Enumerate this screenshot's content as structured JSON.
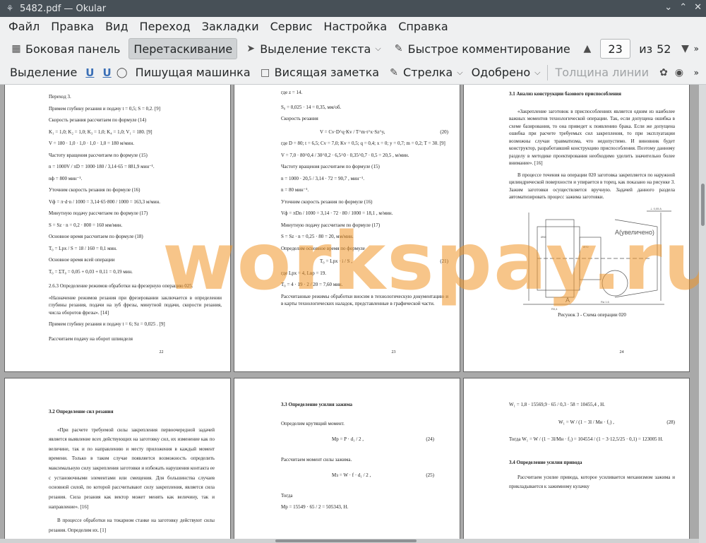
{
  "window": {
    "title": "5482.pdf — Okular"
  },
  "menu": [
    "Файл",
    "Правка",
    "Вид",
    "Переход",
    "Закладки",
    "Сервис",
    "Настройка",
    "Справка"
  ],
  "toolbar1": {
    "sidebar_label": "Боковая панель",
    "drag_label": "Перетаскивание",
    "text_select_label": "Выделение текста",
    "quick_comment_label": "Быстрое комментирование",
    "current_page": "23",
    "of_label": "из",
    "total_pages": "52"
  },
  "toolbar2": {
    "selection_label": "Выделение",
    "typewriter_label": "Пишущая машинка",
    "sticky_note_label": "Висящая заметка",
    "arrow_label": "Стрелка",
    "stamp_label": "Одобрено",
    "line_width_label": "Толщина линии"
  },
  "watermark": "workspay.ru",
  "pages": {
    "p22": {
      "lines": [
        "Переход 3.",
        "Примем глубину резания и подачу  t = 0,5; S = 0,2. [9]",
        "Скорость резания рассчитаем по формуле (14)",
        "K₁ = 1,0; K₂ = 1,0; K₃ = 1,0; K₄ = 1,0;  V₁ = 180. [9]",
        "V = 180 · 1,0 · 1,0 · 1,0 · 1,0 = 180 м/мин.",
        "Частоту вращения рассчитаем по формуле (15)",
        "n = 1000V / πD = 1000·180 / 3,14·65 = 881,9 мин⁻¹.",
        "nф = 800 мин⁻¹.",
        "Уточним скорость резания по формуле (16)",
        "Vф = π·d·n / 1000 = 3,14·65·800 / 1000 = 163,3 м/мин.",
        "Минутную подачу рассчитаем по формуле (17)",
        "S = Sz · n = 0,2 · 800 = 160 мм/мин.",
        "Основное время рассчитаем по формуле (18)",
        "T₀ = Lрх / S = 18 / 160 = 0,1 мин.",
        "Основное время всей операции",
        "T₀ = ΣT₀ = 0,05 + 0,03 + 0,11 = 0,19 мин.",
        "2.6.3  Определение режимов обработки на фрезерную операцию 025.",
        "«Назначение режимов резания при фрезеровании заключается в определении глубины резания, подачи на зуб фрезы, минутной подачи, скорости резания, числа оборотов фрезы». [14]",
        "Примем глубину резания и подачу  t = 6; Sz = 0,025 . [9]",
        "Рассчитаем подачу на оборот шпинделя"
      ],
      "number": "22"
    },
    "p23": {
      "lines": [
        "где  z = 14.",
        "S₀ = 0,025 · 14 = 0,35, мм/об.",
        "Скорость резания",
        "V = Cv·D^q·Kv / T^m·t^x·Sz^y,",
        "(20)",
        "где  D = 80; t = 6,5; Cv = 7,0; Kv = 0,5; q = 0,4; x = 0; y = 0,7; m = 0,2; T = 30. [9]",
        "V = 7,0 · 80^0,4 / 30^0,2 · 6,5^0 · 0,35^0,7 · 0,5 = 20,5 , м/мин.",
        "Частоту вращения рассчитаем по формуле (15)",
        "n = 1000 · 20,5 / 3,14 · 72 = 90,7 , мин⁻¹.",
        "n = 80  мин⁻¹.",
        "Уточним скорость резания по формуле (16)",
        "Vф = πDn / 1000 = 3,14 · 72 · 80 / 1000 = 18,1 , м/мин.",
        "Минутную подачу рассчитаем по формуле (17)",
        "S = Sz · n = 0,25 · 80 = 20, мм/мин.",
        "Определим основное время по формуле",
        "T₀ = Lрх · i / S ,",
        "(21)",
        "где  Lрх = 4, Lвр = 19.",
        "T₀ = 4 · 19 · 2 / 20 = 7,60 мин.",
        "Рассчитанные режимы обработки вносим в технологическую документацию и в карты технологических наладок, представленные в графической части."
      ],
      "number": "23"
    },
    "p24": {
      "heading": "3.1 Анализ конструкции базового приспособления",
      "lines": [
        "«Закрепление заготовок в приспособлениях является одним из наиболее важных моментов технологической операции. Так, если допущена ошибка в схеме базирования, то она приведет к появлению брака. Если же допущена ошибка при расчете требуемых сил закрепления, то при эксплуатации возможны случаи травматизма, что недопустимо. И виновник будет конструктор, разработавший конструкцию приспособления. Поэтому данному разделу в методике проектирования необходимо уделить значительно более внимание». [16]",
        "В процессе точения на операции 020 заготовка закрепляется по наружной цилиндрической поверхности и упирается в торец, как показано на рисунке 3. Зажим заготовки осуществляется вручную. Задачей данного раздела автоматизировать процесс зажима заготовки."
      ],
      "figure_caption": "Рисунок 3 - Схема операции 020",
      "figure_label": "А(увеличено)",
      "figure_letter": "А",
      "number": "24"
    },
    "p25": {
      "heading": "3.2  Определение сил резания",
      "lines": [
        "«При расчете требуемой силы закрепления первоочередной задачей является выявление всех действующих на заготовку сил, их изменение как по величине, так и по направлению и месту приложения в каждый момент времени. Только в таком случае появляется возможность определить максимальную силу закрепления заготовки и избежать нарушения контакта ее с установочными элементами или смещения. Для большинства случаев основной силой, по которой рассчитывают силу закрепления, является сила резания. Сила резания как вектор может менять как величину, так и направление». [16]",
        "В процессе обработки на токарном станке на заготовку действуют силы резания. Определим их. [1]"
      ]
    },
    "p26": {
      "heading": "3.3  Определение усилия зажима",
      "lines": [
        "Определим крутящий момент.",
        "Mр = P · d₁ / 2 ,",
        "(24)",
        "Рассчитаем момент силы зажима.",
        "Mз = W · f · d₁ / 2 ,",
        "(25)",
        "Тогда",
        "Mр = 15549 · 65 / 2 = 505343, Н."
      ]
    },
    "p27": {
      "heading": "3.4 Определение усилия привода",
      "lines": [
        "W₁ = 1,8 · 15569,9 · 65 / 0,3 · 58 = 10455,4 , Н.",
        "W₁ = W / (1 − 3l / Mн · f₁) ,",
        "(28)",
        "Тогда  W₁ = W / (1 − 3l/Mн · f₁) = 104554 / (1 − 3·12,5/25 · 0,1) = 123005 Н.",
        "Рассчитаем усилие привода, которое усиливается механизмом зажима и прикладывается к зажимному кулачку"
      ]
    }
  }
}
